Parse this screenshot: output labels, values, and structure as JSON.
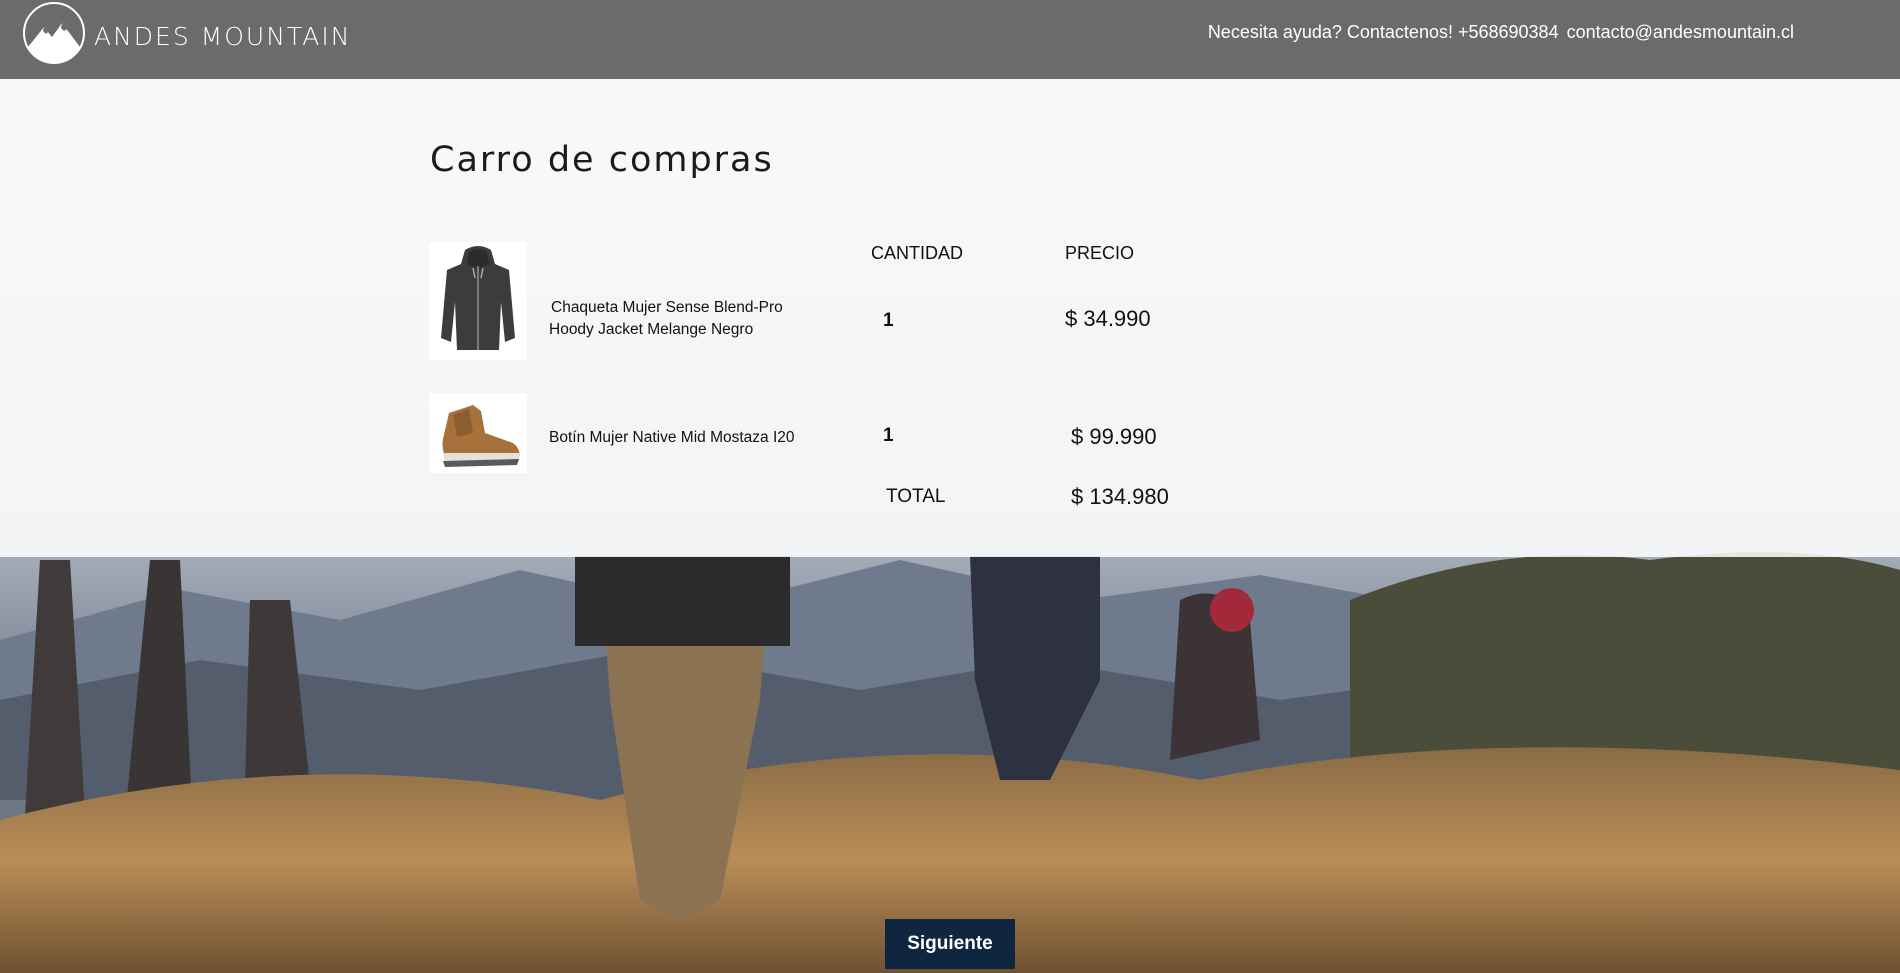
{
  "header": {
    "brand": "ANDES MOUNTAIN",
    "help_text": "Necesita ayuda? Contactenos! +568690384",
    "email": "contacto@andesmountain.cl"
  },
  "cart": {
    "title": "Carro de compras",
    "columns": {
      "quantity": "CANTIDAD",
      "price": "PRECIO"
    },
    "items": [
      {
        "name_line1": "Chaqueta Mujer Sense Blend-Pro",
        "name_line2": "Hoody Jacket Melange Negro",
        "quantity": "1",
        "price": "$ 34.990",
        "icon": "jacket-icon"
      },
      {
        "name_line1": "Botín Mujer Native Mid Mostaza I20",
        "quantity": "1",
        "price": "$ 99.990",
        "icon": "boot-icon"
      }
    ],
    "total_label": "TOTAL",
    "total_value": "$ 134.980"
  },
  "actions": {
    "next_label": "Siguiente"
  },
  "colors": {
    "header_bg": "#6b6b6b",
    "button_bg": "#0f2640"
  }
}
